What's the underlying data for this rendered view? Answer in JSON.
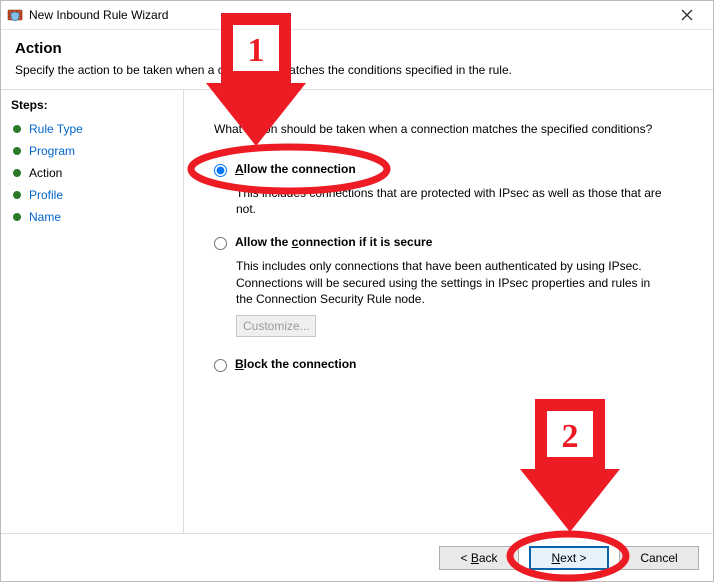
{
  "window": {
    "title": "New Inbound Rule Wizard"
  },
  "header": {
    "title": "Action",
    "description_before": "Specify the action to be taken when a ",
    "description_mid": " mat",
    "description_mid2": "s the c",
    "description_after": " specified in the rule."
  },
  "header_full_description": "Specify the action to be taken when a connection matches the conditions specified in the rule.",
  "sidebar": {
    "label": "Steps:",
    "items": [
      {
        "label": "Rule Type",
        "current": false
      },
      {
        "label": "Program",
        "current": false
      },
      {
        "label": "Action",
        "current": true
      },
      {
        "label": "Profile",
        "current": false
      },
      {
        "label": "Name",
        "current": false
      }
    ]
  },
  "main": {
    "question": "What action should be taken when a connection matches the specified conditions?",
    "options": {
      "allow": {
        "label_pre": "",
        "label_ul": "A",
        "label_post": "llow the connection",
        "desc": "This includes connections that are protected with IPsec as well as those that are not.",
        "checked": true
      },
      "allow_secure": {
        "label_pre": "Allow the ",
        "label_ul": "c",
        "label_post": "onnection if it is secure",
        "desc": "This includes only connections that have been authenticated by using IPsec. Connections will be secured using the settings in IPsec properties and rules in the Connection Security Rule node.",
        "checked": false,
        "customize_label": "Customize..."
      },
      "block": {
        "label_pre": "",
        "label_ul": "B",
        "label_post": "lock the connection",
        "checked": false
      }
    }
  },
  "footer": {
    "back_pre": "< ",
    "back_ul": "B",
    "back_post": "ack",
    "next_ul": "N",
    "next_post": "ext >",
    "cancel": "Cancel"
  },
  "annotations": {
    "step1": "1",
    "step2": "2"
  }
}
